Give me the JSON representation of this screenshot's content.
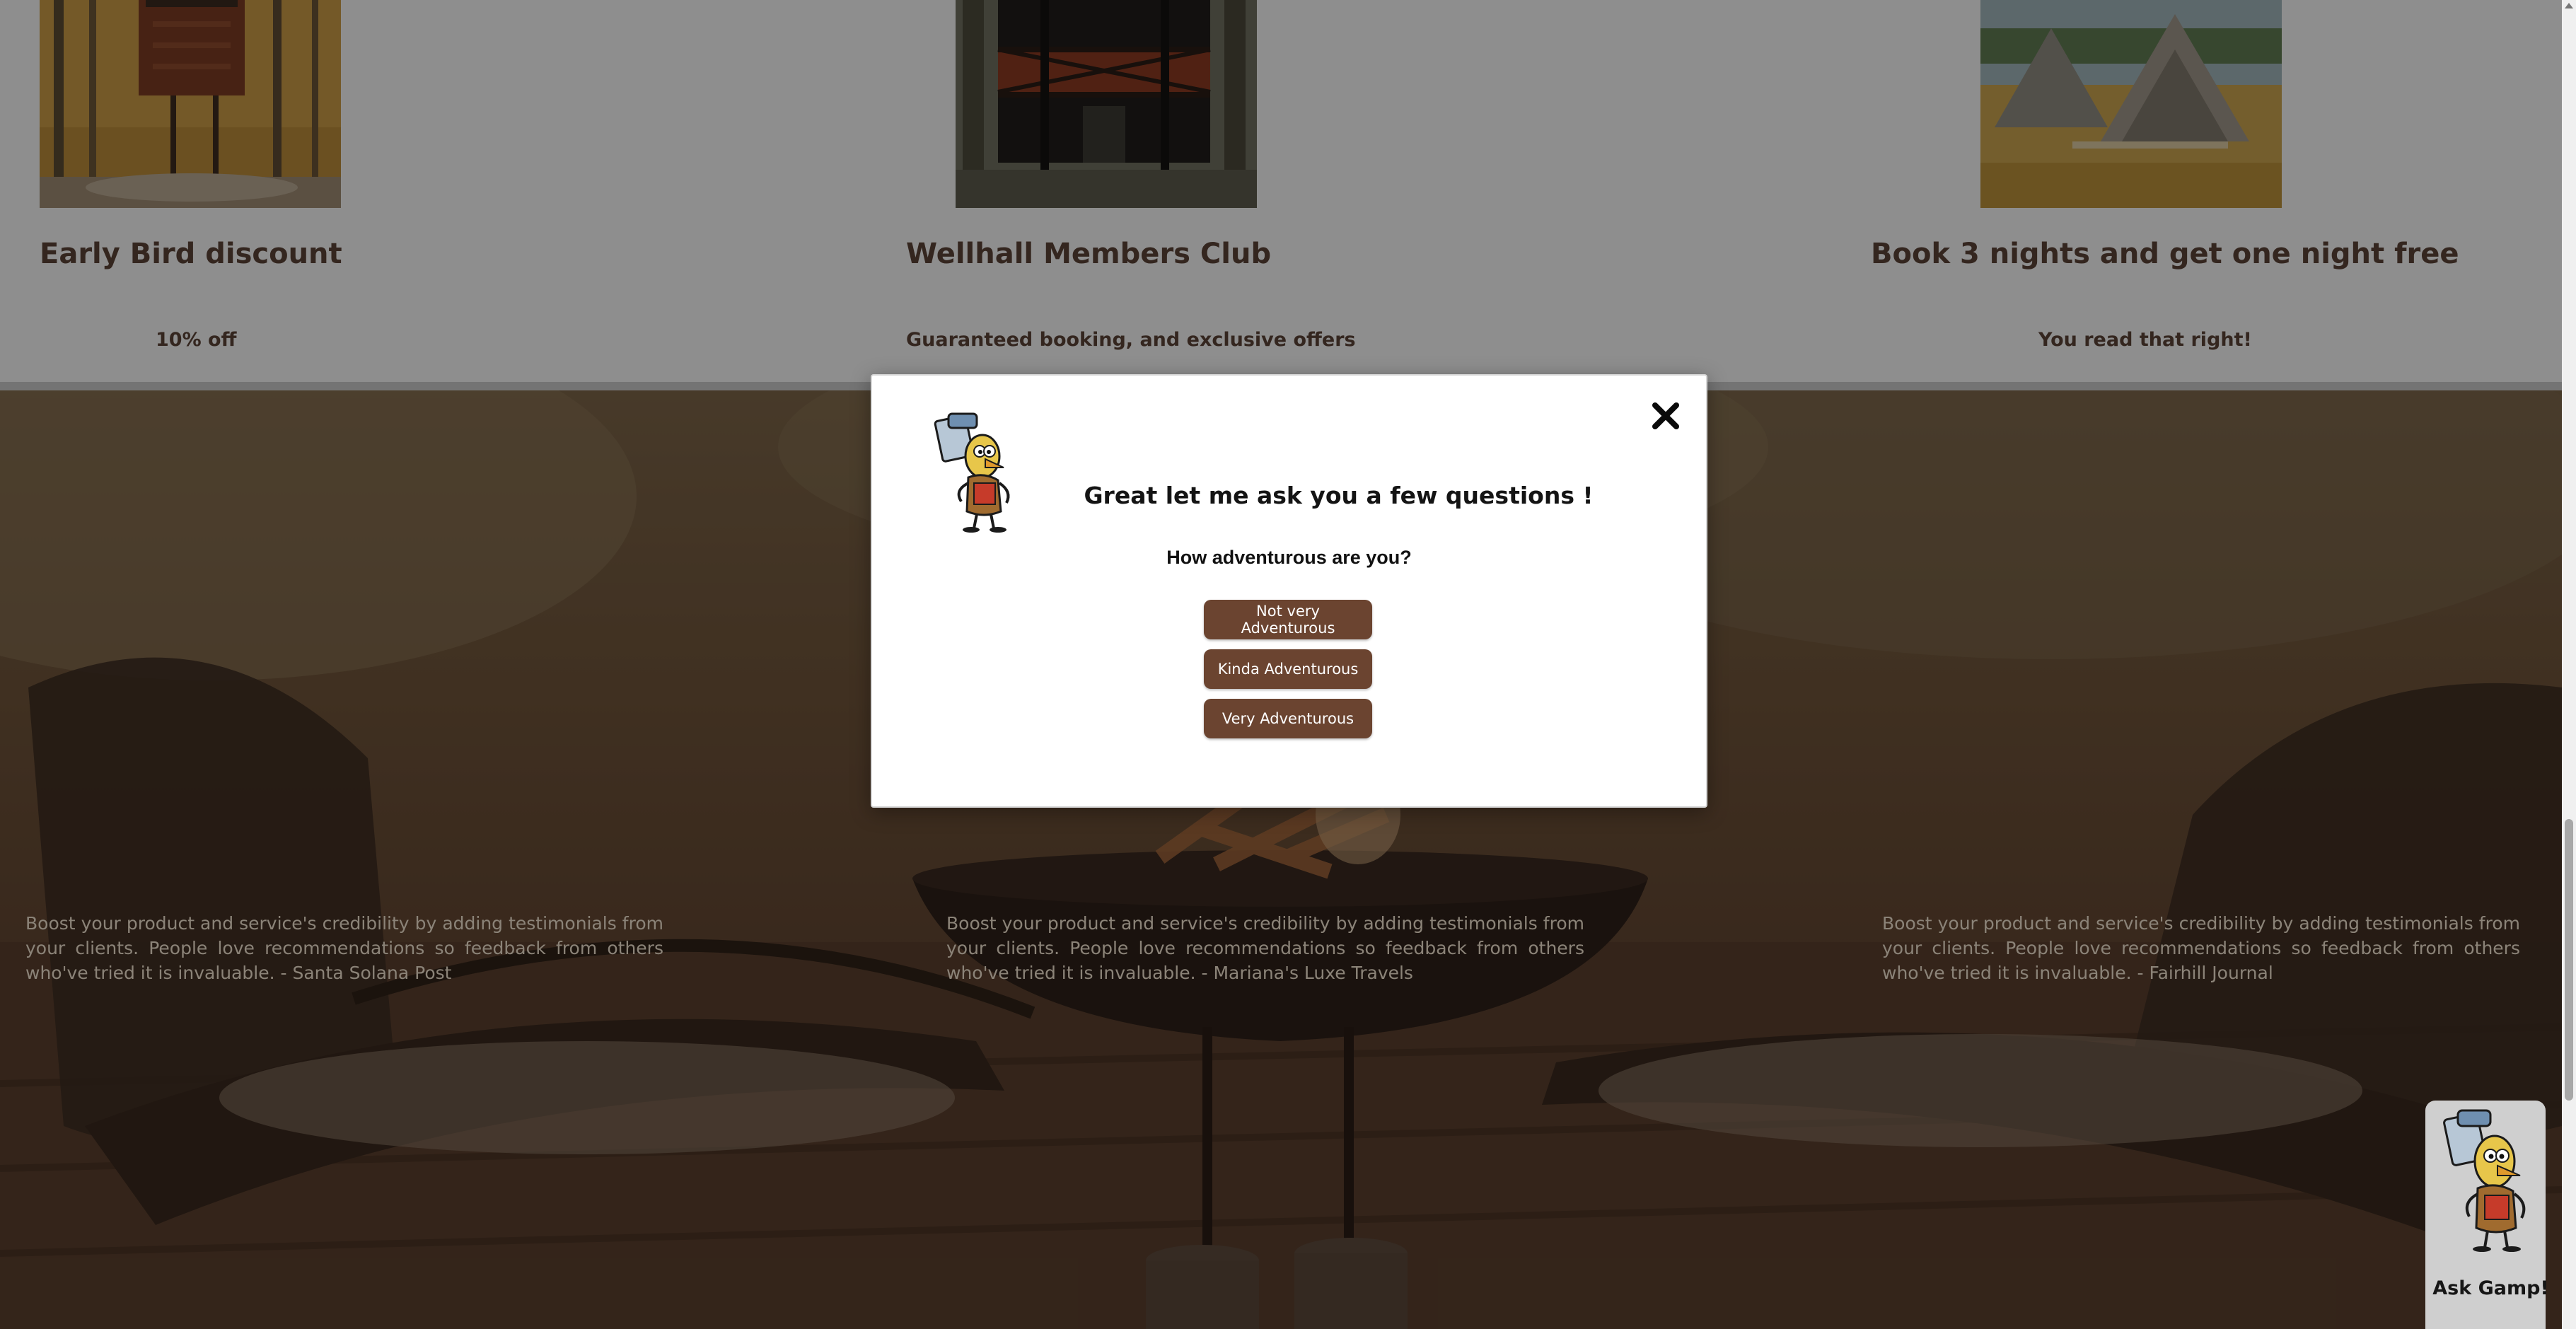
{
  "offers": [
    {
      "title": "Early Bird discount",
      "subtitle": "10% off",
      "image_icon": "treehouse-photo"
    },
    {
      "title": "Wellhall Members Club",
      "subtitle": "Guaranteed booking, and exclusive offers",
      "image_icon": "cabin-tower-photo"
    },
    {
      "title": "Book 3 nights and get one night free",
      "subtitle": "You read that right!",
      "image_icon": "a-frame-cabins-photo"
    }
  ],
  "testimonials": [
    {
      "text": "Boost your product and service's credibility by adding testimonials from your clients. People love recommendations so feedback from others who've tried it is invaluable. - Santa Solana Post"
    },
    {
      "text": "Boost your product and service's credibility by adding testimonials from your clients. People love recommendations so feedback from others who've tried it is invaluable. - Mariana's Luxe Travels"
    },
    {
      "text": "Boost your product and service's credibility by adding testimonials from your clients. People love recommendations so feedback from others who've tried it is invaluable. - Fairhill Journal"
    }
  ],
  "modal": {
    "title": "Great let me ask you a few questions !",
    "question": "How adventurous are you?",
    "answers": [
      "Not very Adventurous",
      "Kinda Adventurous",
      "Very Adventurous"
    ],
    "close_icon": "close-icon",
    "mascot_icon": "mascot-icon"
  },
  "chat_widget": {
    "label": "Ask Gamp!",
    "mascot_icon": "mascot-icon"
  },
  "colors": {
    "brand_brown": "#6b4430",
    "heading_brown": "#5a4336",
    "modal_bg": "#ffffff"
  }
}
